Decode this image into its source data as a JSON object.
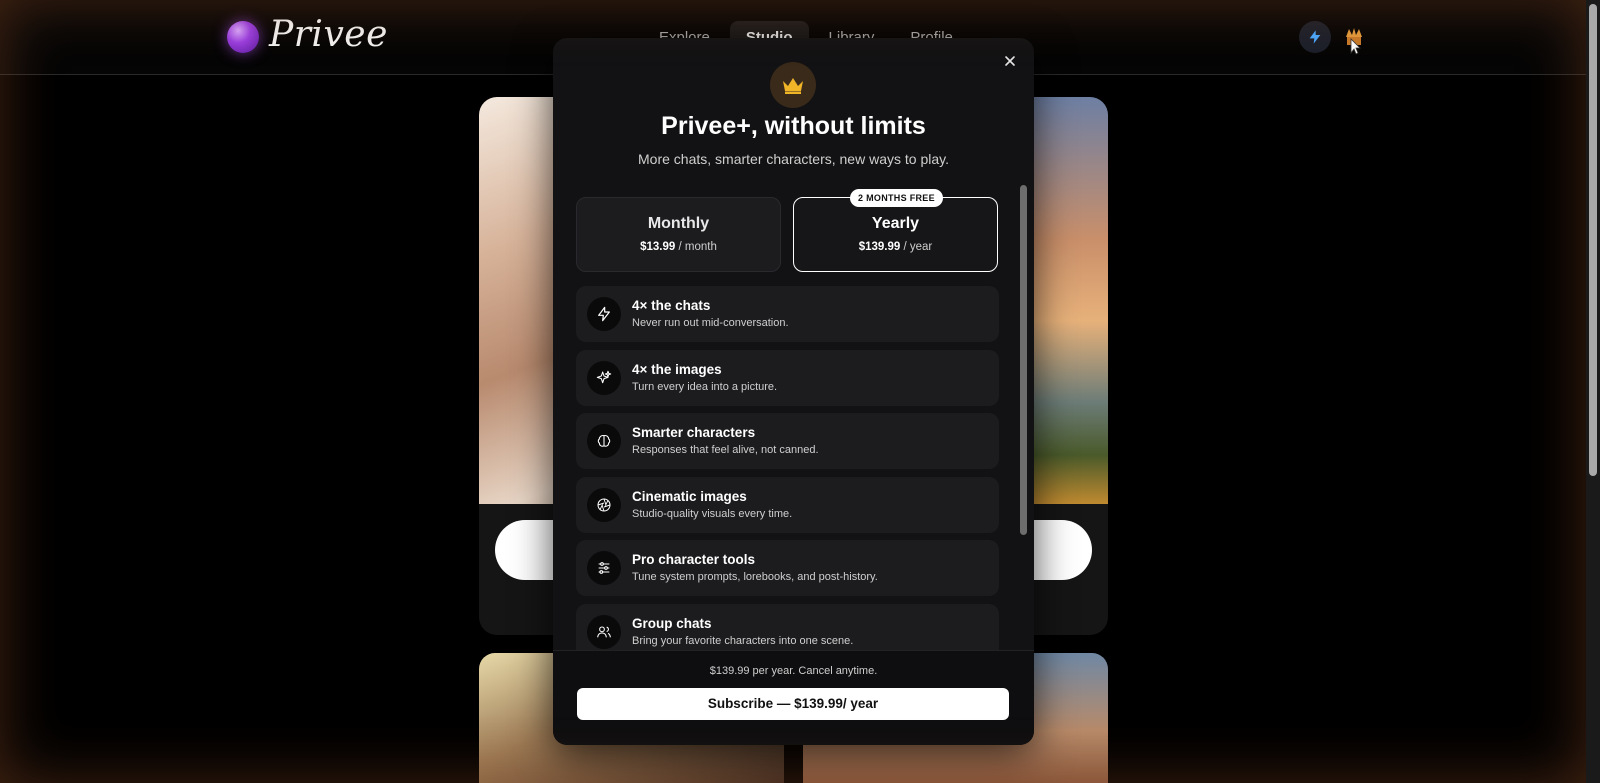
{
  "header": {
    "logo_text": "Privee",
    "nav": [
      {
        "label": "Explore",
        "active": false
      },
      {
        "label": "Studio",
        "active": true
      },
      {
        "label": "Library",
        "active": false
      },
      {
        "label": "Profile",
        "active": false
      }
    ],
    "boost_icon": "lightning-icon",
    "avatar_icon": "user-avatar"
  },
  "modal": {
    "close_icon": "close-icon",
    "badge_icon": "crown-icon",
    "title": "Privee+, without limits",
    "subtitle": "More chats, smarter characters, new ways to play.",
    "plans": [
      {
        "name": "Monthly",
        "price": "$13.99",
        "period": "/ month",
        "selected": false
      },
      {
        "name": "Yearly",
        "price": "$139.99",
        "period": "/ year",
        "selected": true,
        "badge": "2 MONTHS FREE"
      }
    ],
    "features": [
      {
        "icon": "lightning-icon",
        "title": "4× the chats",
        "desc": "Never run out mid-conversation."
      },
      {
        "icon": "sparkles-icon",
        "title": "4× the images",
        "desc": "Turn every idea into a picture."
      },
      {
        "icon": "brain-icon",
        "title": "Smarter characters",
        "desc": "Responses that feel alive, not canned."
      },
      {
        "icon": "aperture-icon",
        "title": "Cinematic images",
        "desc": "Studio-quality visuals every time."
      },
      {
        "icon": "sliders-icon",
        "title": "Pro character tools",
        "desc": "Tune system prompts, lorebooks, and post-history."
      },
      {
        "icon": "users-icon",
        "title": "Group chats",
        "desc": "Bring your favorite characters into one scene."
      }
    ],
    "footer_note": "$139.99 per year. Cancel anytime.",
    "subscribe_label": "Subscribe — $139.99/ year"
  },
  "colors": {
    "accent_glow": "#9a3ee0",
    "boost": "#4aa8ff",
    "crown": "#f0b429"
  }
}
